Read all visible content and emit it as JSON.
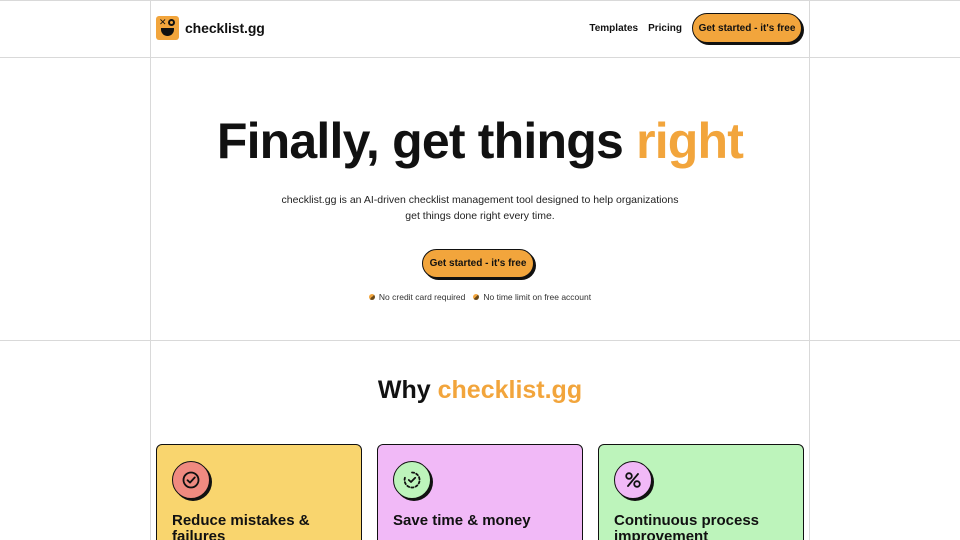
{
  "brand": {
    "name": "checklist.gg",
    "accent": "#f2a53c"
  },
  "nav": {
    "links": [
      "Templates",
      "Pricing"
    ],
    "cta": "Get started - it's free"
  },
  "hero": {
    "title_main": "Finally, get things ",
    "title_accent": "right",
    "description": "checklist.gg is an AI-driven checklist management tool designed to help organizations get things done right every time.",
    "cta": "Get started - it's free",
    "perks": [
      "No credit card required",
      "No time limit on free account"
    ]
  },
  "why": {
    "title_main": "Why ",
    "title_accent": "checklist.gg",
    "cards": [
      {
        "title": "Reduce mistakes & failures",
        "icon": "check-circle-icon",
        "color": "#f9d56e"
      },
      {
        "title": "Save time & money",
        "icon": "stopwatch-check-icon",
        "color": "#f1b9f7"
      },
      {
        "title": "Continuous process improvement",
        "icon": "percent-icon",
        "color": "#bdf4bb"
      }
    ]
  }
}
